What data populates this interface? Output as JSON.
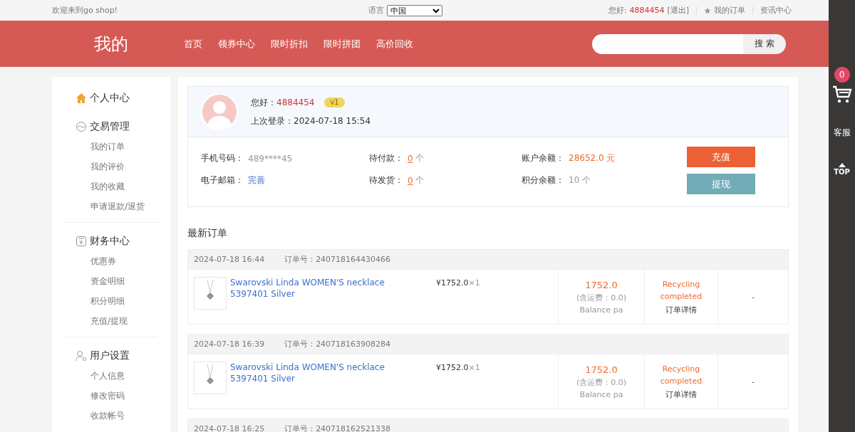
{
  "top_bar": {
    "welcome": "欢迎来到go shop!",
    "language_label": "语言",
    "language_value": "中国",
    "greeting_label": "您好:",
    "username": "4884454",
    "logout": "[退出]",
    "my_orders": "我的订单",
    "news": "资讯中心"
  },
  "header": {
    "title": "我的",
    "nav": [
      "首页",
      "领券中心",
      "限时折扣",
      "限时拼团",
      "高价回收"
    ],
    "search_button": "搜 索"
  },
  "sidebar": [
    {
      "title": "个人中心",
      "kind": "home"
    },
    {
      "title": "交易管理",
      "kind": "trade",
      "items": [
        "我的订单",
        "我的评价",
        "我的收藏",
        "申请退款/退货"
      ]
    },
    {
      "title": "财务中心",
      "kind": "finance",
      "items": [
        "优惠券",
        "资金明细",
        "积分明细",
        "充值/提现"
      ]
    },
    {
      "title": "用户设置",
      "kind": "user",
      "items": [
        "个人信息",
        "修改密码",
        "收款帐号"
      ]
    }
  ],
  "profile": {
    "greeting_label": "您好：",
    "username": "4884454",
    "level": "v1",
    "last_login_label": "上次登录：",
    "last_login": "2024-07-18 15:54"
  },
  "stats": [
    {
      "label": "手机号码：",
      "value": "489****45",
      "kind": "plain"
    },
    {
      "label": "待付款：",
      "value": "0",
      "unit": "个",
      "kind": "count"
    },
    {
      "label": "账户余额：",
      "value": "28652.0 元",
      "kind": "money"
    },
    {
      "label": "电子邮箱：",
      "value": "完善",
      "kind": "link"
    },
    {
      "label": "待发货：",
      "value": "0",
      "unit": "个",
      "kind": "count"
    },
    {
      "label": "积分余额：",
      "value": "10 个",
      "kind": "plain"
    }
  ],
  "buttons": [
    {
      "label": "充值",
      "kind": "primary"
    },
    {
      "label": "提现",
      "kind": "secondary"
    }
  ],
  "orders_title": "最新订单",
  "orders": [
    {
      "time": "2024-07-18 16:44",
      "number_label": "订单号：",
      "number": "240718164430466",
      "product": "Swarovski Linda WOMEN'S necklace 5397401 Silver",
      "price": "¥1752.0",
      "qty": "×1",
      "total": "1752.0",
      "shipping": "(含运费：0.0)",
      "payment": "Balance pa",
      "status": "Recycling completed",
      "detail": "订单详情",
      "action": "-"
    },
    {
      "time": "2024-07-18 16:39",
      "number_label": "订单号：",
      "number": "240718163908284",
      "product": "Swarovski Linda WOMEN'S necklace 5397401 Silver",
      "price": "¥1752.0",
      "qty": "×1",
      "total": "1752.0",
      "shipping": "(含运费：0.0)",
      "payment": "Balance pa",
      "status": "Recycling completed",
      "detail": "订单详情",
      "action": "-"
    },
    {
      "time": "2024-07-18 16:25",
      "number_label": "订单号：",
      "number": "240718162521338"
    }
  ],
  "side_toolbar": {
    "cart_count": "0",
    "service": "客服",
    "top": "TOP"
  }
}
